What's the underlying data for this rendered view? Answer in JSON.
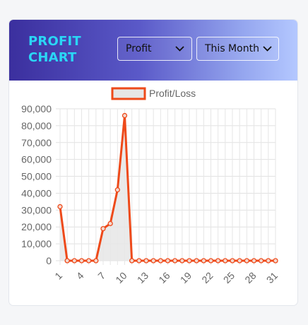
{
  "header": {
    "title": "PROFIT CHART",
    "metric_select": "Profit",
    "period_select": "This Month"
  },
  "icons": [
    "chevron-down-icon"
  ],
  "colors": {
    "line": "#ee4a1a",
    "fill": "#e6e6e6",
    "title": "#2ad6f5",
    "header_start": "#3b2f9e",
    "header_end": "#b4c8ff"
  },
  "chart_data": {
    "type": "line",
    "legend": "Profit/Loss",
    "legend_position": "top",
    "grid": true,
    "x": [
      1,
      2,
      3,
      4,
      5,
      6,
      7,
      8,
      9,
      10,
      11,
      12,
      13,
      14,
      15,
      16,
      17,
      18,
      19,
      20,
      21,
      22,
      23,
      24,
      25,
      26,
      27,
      28,
      29,
      30,
      31
    ],
    "x_tick_labels": [
      "1",
      "4",
      "7",
      "10",
      "13",
      "16",
      "19",
      "22",
      "25",
      "28",
      "31"
    ],
    "series": [
      {
        "name": "Profit/Loss",
        "values": [
          32000,
          0,
          0,
          0,
          0,
          0,
          19000,
          22000,
          42000,
          86000,
          0,
          0,
          0,
          0,
          0,
          0,
          0,
          0,
          0,
          0,
          0,
          0,
          0,
          0,
          0,
          0,
          0,
          0,
          0,
          0,
          0
        ]
      }
    ],
    "ylim": [
      0,
      90000
    ],
    "y_ticks": [
      0,
      10000,
      20000,
      30000,
      40000,
      50000,
      60000,
      70000,
      80000,
      90000
    ],
    "y_tick_labels": [
      "0",
      "10,000",
      "20,000",
      "30,000",
      "40,000",
      "50,000",
      "60,000",
      "70,000",
      "80,000",
      "90,000"
    ]
  }
}
